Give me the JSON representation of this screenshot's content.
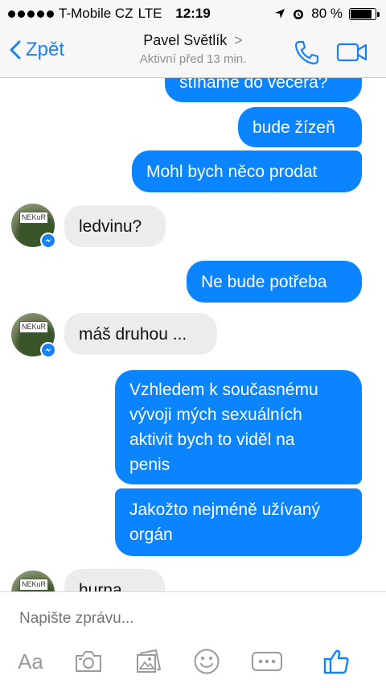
{
  "status_bar": {
    "carrier": "T-Mobile CZ",
    "network": "LTE",
    "time": "12:19",
    "battery_text": "80 %",
    "battery_level": 0.8
  },
  "nav": {
    "back_label": "Zpět",
    "contact_name": "Pavel Světlík",
    "contact_chevron": ">",
    "contact_status": "Aktivní před 13 min.",
    "icons": [
      "phone-icon",
      "video-camera-icon"
    ]
  },
  "messages": [
    {
      "direction": "out",
      "text": "stíháme do večera?"
    },
    {
      "direction": "out",
      "text": "bude žízeň"
    },
    {
      "direction": "out",
      "text": "Mohl bych něco prodat"
    },
    {
      "direction": "in",
      "text": "ledvinu?"
    },
    {
      "direction": "out",
      "text": "Ne bude potřeba"
    },
    {
      "direction": "in",
      "text": "máš druhou ..."
    },
    {
      "direction": "out",
      "lines": [
        "Vzhledem k současnému",
        "vývoji mých sexuálních",
        "aktivit bych to viděl na",
        "penis"
      ]
    },
    {
      "direction": "out",
      "lines": [
        "Jakožto nejméně užívaný",
        "orgán"
      ]
    },
    {
      "direction": "in",
      "text": "hurna"
    }
  ],
  "avatar_sign": "NEKuR",
  "composer": {
    "placeholder": "Napište zprávu...",
    "aa_label": "Aa",
    "icons": [
      "camera-icon",
      "gallery-icon",
      "emoji-icon",
      "more-icon",
      "like-icon"
    ]
  },
  "colors": {
    "accent": "#0a84ff",
    "incoming_bubble": "#ececec"
  }
}
